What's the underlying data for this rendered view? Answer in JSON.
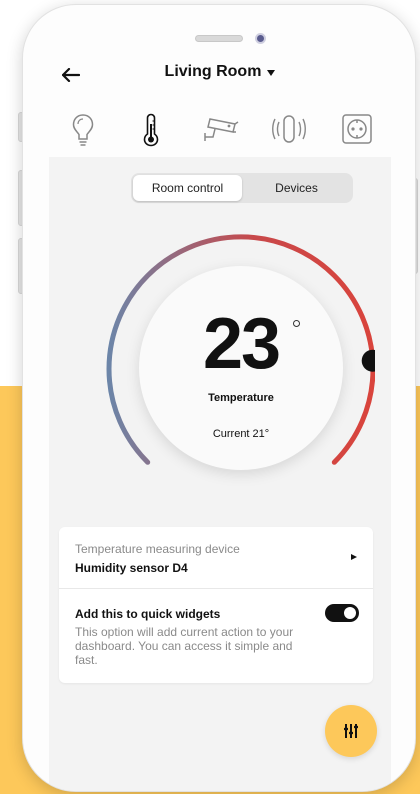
{
  "header": {
    "title": "Living Room",
    "back_icon": "arrow-left-icon",
    "dropdown_icon": "caret-down-icon"
  },
  "device_tabs": [
    {
      "icon": "lightbulb-icon",
      "active": false
    },
    {
      "icon": "thermometer-icon",
      "active": true
    },
    {
      "icon": "security-camera-icon",
      "active": false
    },
    {
      "icon": "vibration-sensor-icon",
      "active": false
    },
    {
      "icon": "power-socket-icon",
      "active": false
    }
  ],
  "segment": {
    "room_control": "Room control",
    "devices": "Devices",
    "selected": "Room control"
  },
  "thermostat": {
    "value": "23",
    "label": "Temperature",
    "current": "Current 21°",
    "setpoint_fraction": 0.82,
    "gradient": {
      "cold": "#6c85a8",
      "warm": "#d9443c"
    }
  },
  "settings": {
    "measuring_label": "Temperature measuring device",
    "measuring_value": "Humidity sensor D4",
    "quick_widgets_title": "Add this to quick widgets",
    "quick_widgets_desc": "This option will add current action to your dashboard. You can access it simple and fast.",
    "quick_widgets_enabled": true
  },
  "fab": {
    "icon": "equalizer-icon"
  },
  "colors": {
    "accent": "#fdc85a",
    "background": "#f3f3f3"
  }
}
